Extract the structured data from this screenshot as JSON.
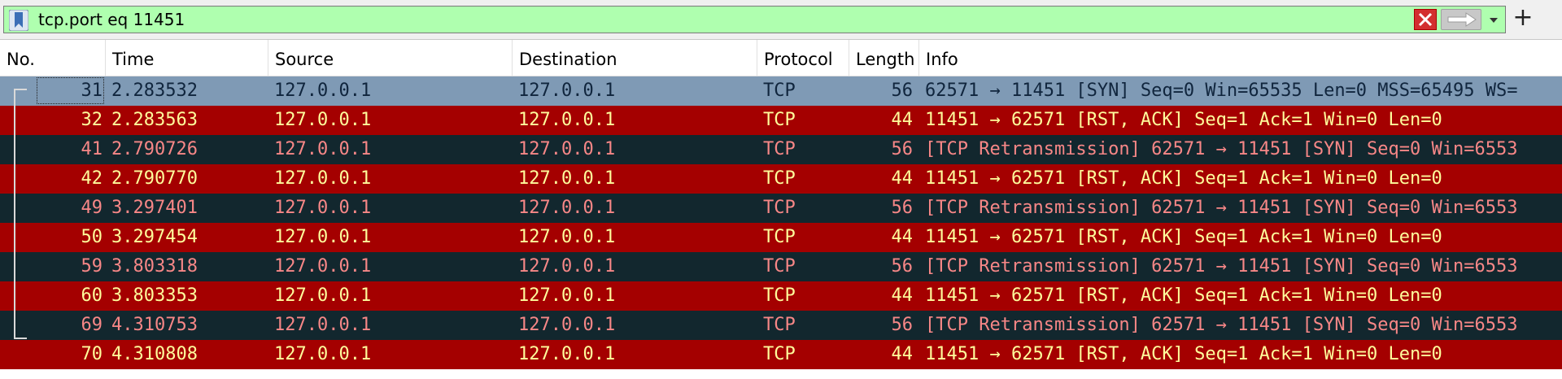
{
  "filter": {
    "value": "tcp.port eq 11451",
    "bookmark_icon": "bookmark-icon",
    "clear_icon": "clear-x-icon",
    "apply_icon": "arrow-right-icon",
    "dropdown_icon": "chevron-down-icon",
    "add_label": "+",
    "bg_color": "#afffaf"
  },
  "columns": [
    {
      "label": "No."
    },
    {
      "label": "Time"
    },
    {
      "label": "Source"
    },
    {
      "label": "Destination"
    },
    {
      "label": "Protocol"
    },
    {
      "label": "Length"
    },
    {
      "label": "Info"
    }
  ],
  "colors": {
    "selected_bg": "#7f9ab5",
    "selected_fg": "#10253d",
    "syn_bg": "#12272e",
    "syn_fg": "#f78787",
    "rst_bg": "#a40000",
    "rst_fg": "#fffc9c"
  },
  "packets": [
    {
      "no": "31",
      "time": "2.283532",
      "source": "127.0.0.1",
      "destination": "127.0.0.1",
      "protocol": "TCP",
      "length": "56",
      "info": "62571 → 11451 [SYN] Seq=0 Win=65535 Len=0 MSS=65495 WS=",
      "style": "selected"
    },
    {
      "no": "32",
      "time": "2.283563",
      "source": "127.0.0.1",
      "destination": "127.0.0.1",
      "protocol": "TCP",
      "length": "44",
      "info": "11451 → 62571 [RST, ACK] Seq=1 Ack=1 Win=0 Len=0",
      "style": "rst"
    },
    {
      "no": "41",
      "time": "2.790726",
      "source": "127.0.0.1",
      "destination": "127.0.0.1",
      "protocol": "TCP",
      "length": "56",
      "info": "[TCP Retransmission] 62571 → 11451 [SYN] Seq=0 Win=6553",
      "style": "syn"
    },
    {
      "no": "42",
      "time": "2.790770",
      "source": "127.0.0.1",
      "destination": "127.0.0.1",
      "protocol": "TCP",
      "length": "44",
      "info": "11451 → 62571 [RST, ACK] Seq=1 Ack=1 Win=0 Len=0",
      "style": "rst"
    },
    {
      "no": "49",
      "time": "3.297401",
      "source": "127.0.0.1",
      "destination": "127.0.0.1",
      "protocol": "TCP",
      "length": "56",
      "info": "[TCP Retransmission] 62571 → 11451 [SYN] Seq=0 Win=6553",
      "style": "syn"
    },
    {
      "no": "50",
      "time": "3.297454",
      "source": "127.0.0.1",
      "destination": "127.0.0.1",
      "protocol": "TCP",
      "length": "44",
      "info": "11451 → 62571 [RST, ACK] Seq=1 Ack=1 Win=0 Len=0",
      "style": "rst"
    },
    {
      "no": "59",
      "time": "3.803318",
      "source": "127.0.0.1",
      "destination": "127.0.0.1",
      "protocol": "TCP",
      "length": "56",
      "info": "[TCP Retransmission] 62571 → 11451 [SYN] Seq=0 Win=6553",
      "style": "syn"
    },
    {
      "no": "60",
      "time": "3.803353",
      "source": "127.0.0.1",
      "destination": "127.0.0.1",
      "protocol": "TCP",
      "length": "44",
      "info": "11451 → 62571 [RST, ACK] Seq=1 Ack=1 Win=0 Len=0",
      "style": "rst"
    },
    {
      "no": "69",
      "time": "4.310753",
      "source": "127.0.0.1",
      "destination": "127.0.0.1",
      "protocol": "TCP",
      "length": "56",
      "info": "[TCP Retransmission] 62571 → 11451 [SYN] Seq=0 Win=6553",
      "style": "syn"
    },
    {
      "no": "70",
      "time": "4.310808",
      "source": "127.0.0.1",
      "destination": "127.0.0.1",
      "protocol": "TCP",
      "length": "44",
      "info": "11451 → 62571 [RST, ACK] Seq=1 Ack=1 Win=0 Len=0",
      "style": "rst"
    }
  ]
}
